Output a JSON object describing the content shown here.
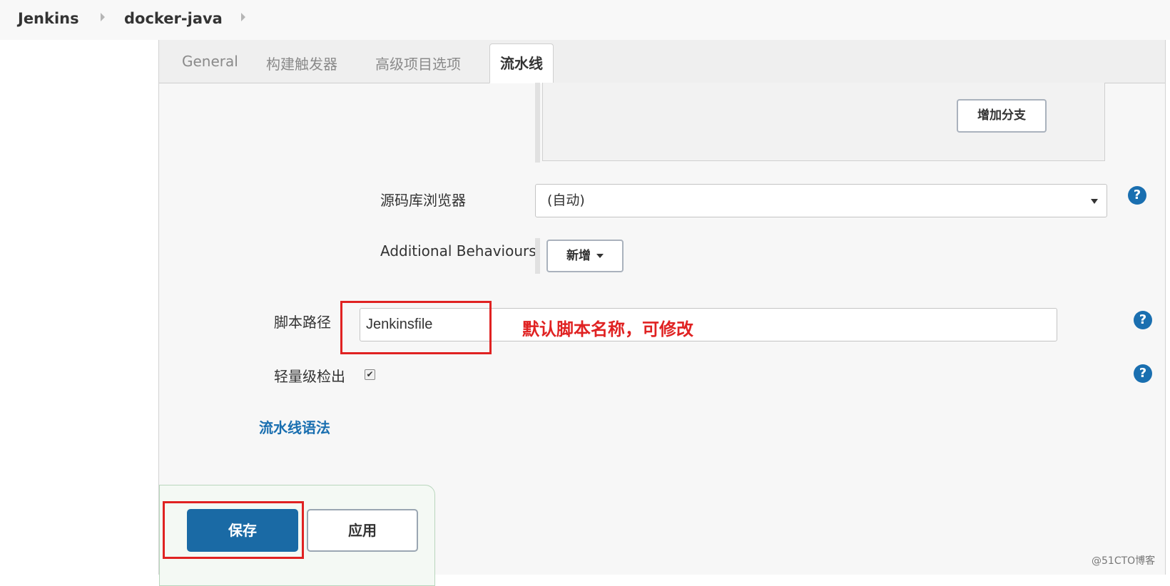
{
  "breadcrumb": {
    "items": [
      {
        "label": "Jenkins"
      },
      {
        "label": "docker-java"
      }
    ]
  },
  "tabs": [
    {
      "label": "General",
      "active": false
    },
    {
      "label": "构建触发器",
      "active": false
    },
    {
      "label": "高级项目选项",
      "active": false
    },
    {
      "label": "流水线",
      "active": true
    }
  ],
  "branch": {
    "add_branch_label": "增加分支"
  },
  "repo_browser": {
    "label": "源码库浏览器",
    "value": "(自动)"
  },
  "additional_behaviours": {
    "label": "Additional Behaviours",
    "add_label": "新增"
  },
  "script_path": {
    "label": "脚本路径",
    "value": "Jenkinsfile"
  },
  "lightweight_checkout": {
    "label": "轻量级检出",
    "checked": true,
    "check_mark": "✔"
  },
  "help": {
    "symbol": "?"
  },
  "pipeline_syntax": {
    "label": "流水线语法"
  },
  "annotation": {
    "text": "默认脚本名称，可修改",
    "color": "#e02222"
  },
  "actions": {
    "save_label": "保存",
    "apply_label": "应用"
  },
  "watermark": {
    "text": "@51CTO博客"
  },
  "colors": {
    "primary": "#1a6aa5",
    "help": "#1a6fb0",
    "highlight": "#e02222"
  }
}
